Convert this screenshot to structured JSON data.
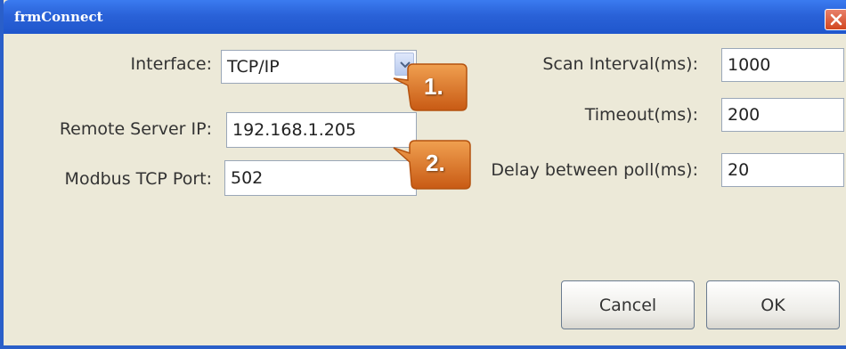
{
  "window": {
    "title": "frmConnect"
  },
  "left": {
    "interface_label": "Interface:",
    "interface_value": "TCP/IP",
    "remote_ip_label": "Remote Server IP:",
    "remote_ip_value": "192.168.1.205",
    "port_label": "Modbus TCP Port:",
    "port_value": "502"
  },
  "right": {
    "scan_label": "Scan Interval(ms):",
    "scan_value": "1000",
    "timeout_label": "Timeout(ms):",
    "timeout_value": "200",
    "delay_label": "Delay between poll(ms):",
    "delay_value": "20"
  },
  "buttons": {
    "cancel": "Cancel",
    "ok": "OK"
  },
  "callouts": [
    "1.",
    "2."
  ],
  "colors": {
    "titlebar": "#2a62d8",
    "callout": "#e0782a",
    "dialog_bg": "#ece9d8"
  },
  "icons": [
    "close-icon",
    "chevron-down-icon"
  ]
}
